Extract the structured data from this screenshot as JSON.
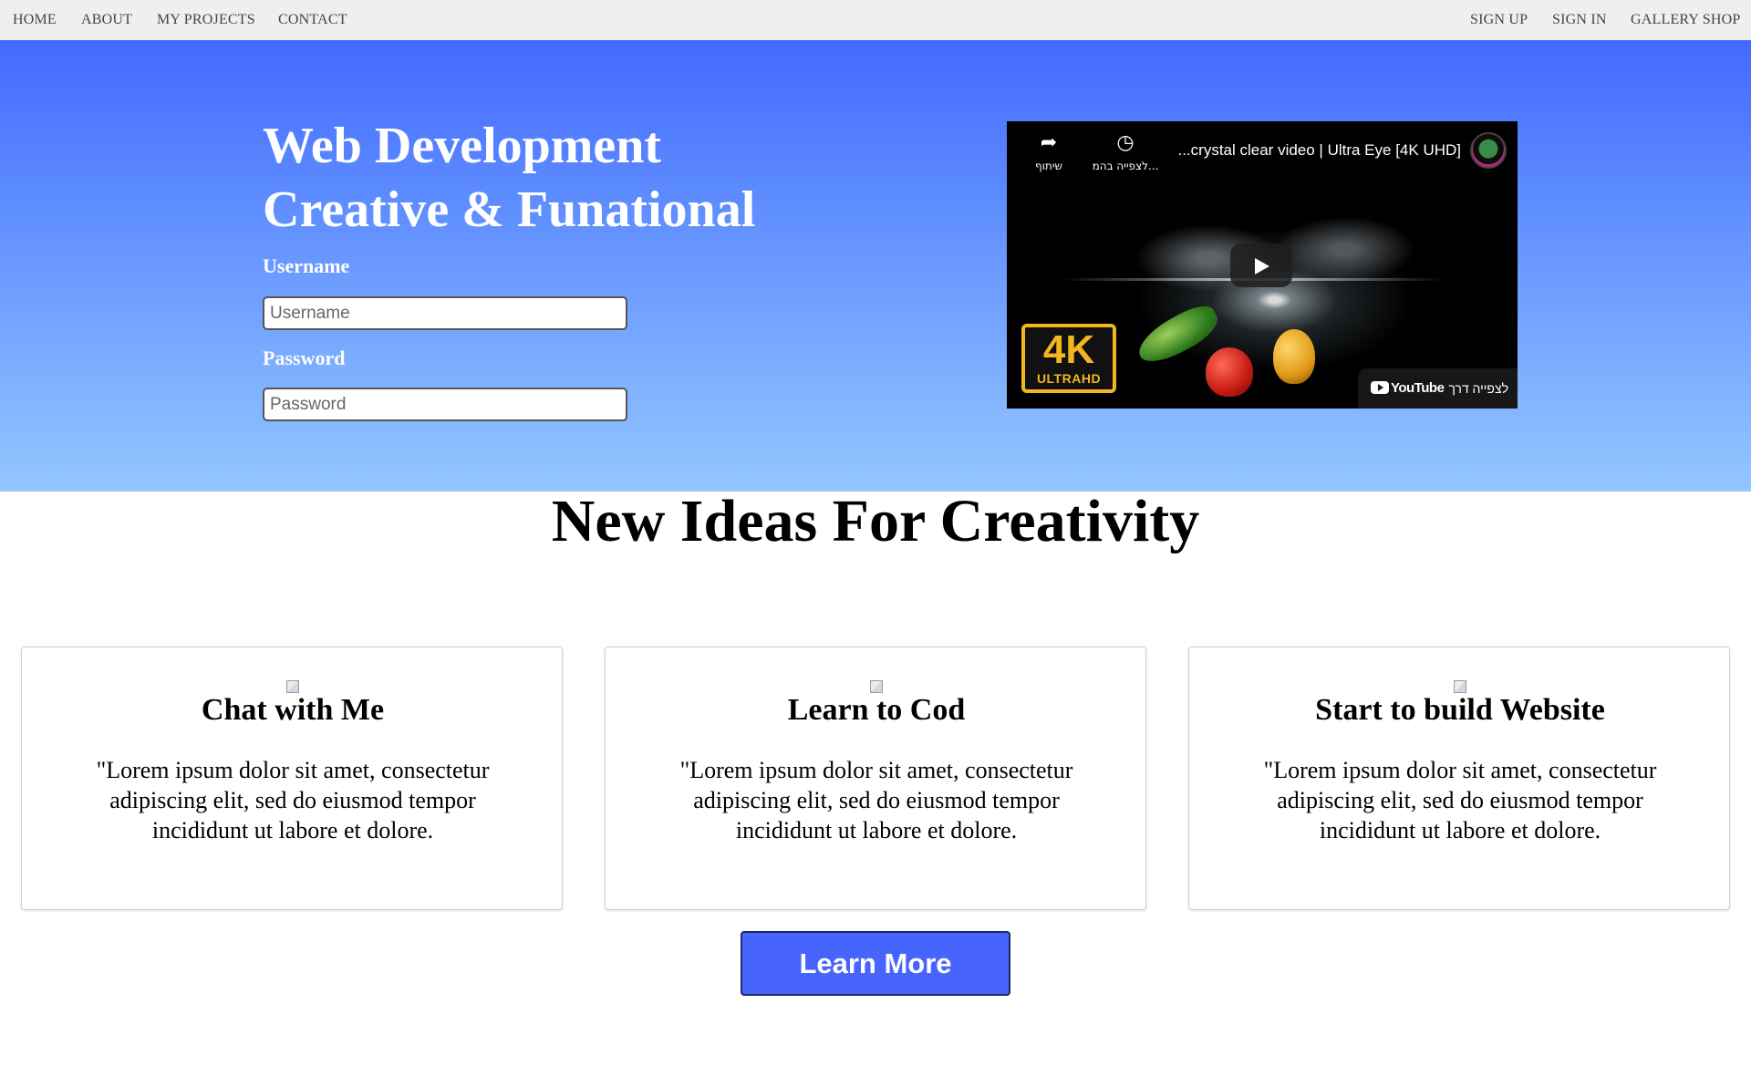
{
  "nav": {
    "left": [
      "HOME",
      "ABOUT",
      "MY PROJECTS",
      "CONTACT"
    ],
    "right": [
      "SIGN UP",
      "SIGN IN",
      "GALLERY SHOP"
    ]
  },
  "hero": {
    "title_line1": "Web Development",
    "title_line2": "Creative & Funational",
    "username_label": "Username",
    "username_placeholder": "Username",
    "password_label": "Password",
    "password_placeholder": "Password"
  },
  "video": {
    "title": "...crystal clear video | Ultra Eye [4K UHD]",
    "share_label": "שיתוף",
    "watch_later_label": "לצפייה בהמ...",
    "badge_big": "4K",
    "badge_small": "ULTRAHD",
    "youtube_logo": "YouTube",
    "watch_on_label": "לצפייה דרך",
    "icons": [
      "share-icon",
      "clock-icon",
      "play-icon",
      "youtube-logo"
    ]
  },
  "section": {
    "title": "New Ideas For Creativity"
  },
  "cards": [
    {
      "title": "Chat with Me",
      "text": "\"Lorem ipsum dolor sit amet, consectetur adipiscing elit, sed do eiusmod tempor incididunt ut labore et dolore."
    },
    {
      "title": "Learn to Cod",
      "text": "\"Lorem ipsum dolor sit amet, consectetur adipiscing elit, sed do eiusmod tempor incididunt ut labore et dolore."
    },
    {
      "title": "Start to build Website",
      "text": "\"Lorem ipsum dolor sit amet, consectetur adipiscing elit, sed do eiusmod tempor incididunt ut labore et dolore."
    }
  ],
  "cta": {
    "label": "Learn More"
  },
  "colors": {
    "nav_bg": "#efefef",
    "hero_top": "#4468ff",
    "hero_bottom": "#93c6ff",
    "button": "#4765fc",
    "badge_gold": "#f2b61e"
  }
}
